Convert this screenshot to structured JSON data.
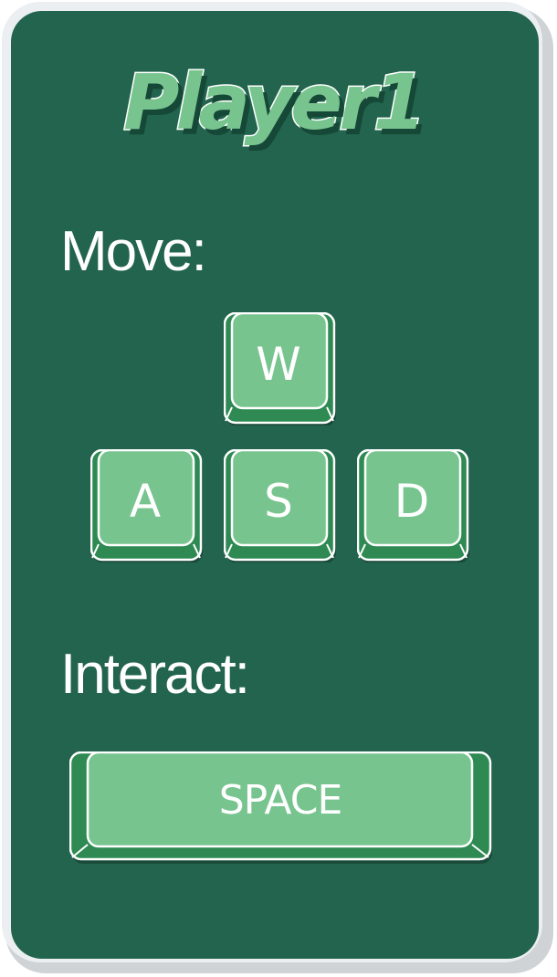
{
  "title": "Player1",
  "move_label": "Move:",
  "interact_label": "Interact:",
  "keys": {
    "up": "W",
    "left": "A",
    "down": "S",
    "right": "D",
    "interact": "SPACE"
  },
  "colors": {
    "panel": "#22644d",
    "key_top": "#78c48f",
    "key_side": "#2e8a52",
    "outline": "#ffffff"
  }
}
